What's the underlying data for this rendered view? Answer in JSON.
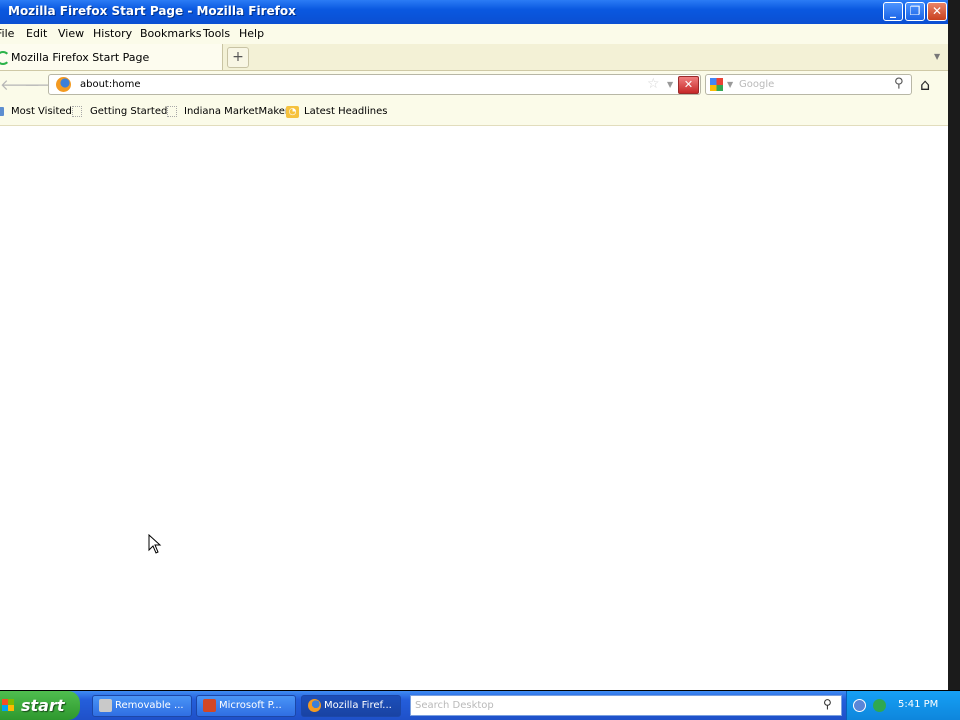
{
  "window": {
    "title": "Mozilla Firefox Start Page - Mozilla Firefox",
    "minimize_icon": "minimize-icon",
    "maximize_icon": "restore-icon",
    "close_icon": "close-icon"
  },
  "menu": {
    "items": [
      "File",
      "Edit",
      "View",
      "History",
      "Bookmarks",
      "Tools",
      "Help"
    ]
  },
  "tabs": {
    "active_label": "Mozilla Firefox Start Page",
    "new_tab_label": "+"
  },
  "nav": {
    "back_icon": "back-arrow-icon",
    "forward_icon": "forward-arrow-icon",
    "url": "about:home",
    "search_placeholder": "Google",
    "home_icon": "home-icon"
  },
  "bookmarks": {
    "items": [
      "Most Visited",
      "Getting Started",
      "Indiana MarketMaker",
      "Latest Headlines"
    ]
  },
  "taskbar": {
    "start_label": "start",
    "tasks": [
      "Removable ...",
      "Microsoft P...",
      "Mozilla Firef..."
    ],
    "desktop_search_placeholder": "Search Desktop",
    "clock": "5:41 PM"
  },
  "colors": {
    "titlebar": "#0b55d8",
    "toolbar_bg": "#fbfbe9",
    "taskbar": "#245edb",
    "start_button": "#3aa83a",
    "stop_button": "#c62828"
  }
}
